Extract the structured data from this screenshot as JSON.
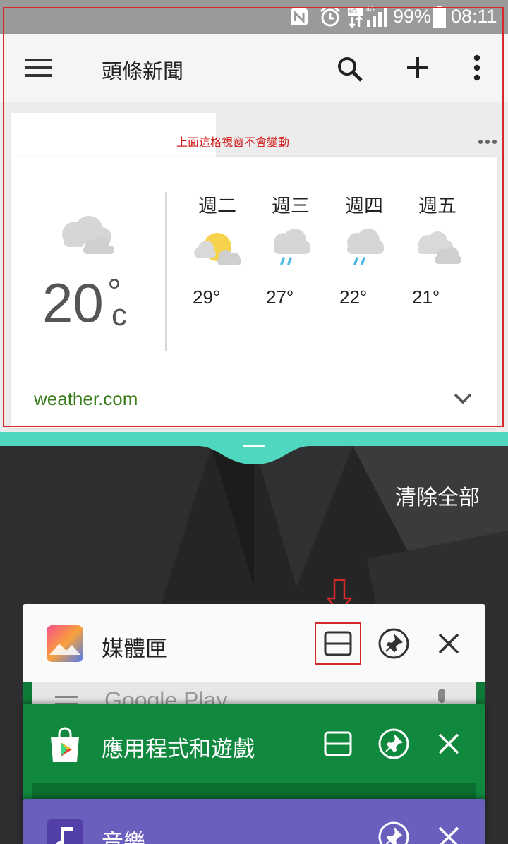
{
  "status_bar": {
    "battery": "99%",
    "time": "08:11",
    "network_type": "4G",
    "icons": [
      "nfc-icon",
      "alarm-icon",
      "data-arrows-icon",
      "signal-icon",
      "battery-icon"
    ]
  },
  "app_bar": {
    "title": "頭條新聞",
    "icons": [
      "menu-icon",
      "search-icon",
      "add-icon",
      "more-vert-icon"
    ]
  },
  "annotation": {
    "note": "上面這格視窗不會變動",
    "color": "#d62929"
  },
  "weather": {
    "current_temp": "20",
    "degree_symbol": "°",
    "unit": "c",
    "current_icon": "cloudy-icon",
    "source": "weather.com",
    "source_color": "#3a7d1c",
    "forecast": [
      {
        "day": "週二",
        "temp": "29°",
        "icon": "partly-sunny-icon"
      },
      {
        "day": "週三",
        "temp": "27°",
        "icon": "rain-icon"
      },
      {
        "day": "週四",
        "temp": "22°",
        "icon": "rain-icon"
      },
      {
        "day": "週五",
        "temp": "21°",
        "icon": "cloudy-icon"
      }
    ]
  },
  "split": {
    "accent": "#4fd8bf"
  },
  "recents": {
    "clear_all": "清除全部",
    "tasks": [
      {
        "name": "媒體匣",
        "header_color": "#fafafa",
        "text_color": "#222222",
        "icon": "gallery-icon"
      },
      {
        "name": "應用程式和遊戲",
        "header_color": "#10883e",
        "text_color": "#ffffff",
        "icon": "play-store-icon",
        "preview_text": "Google Play"
      },
      {
        "name": "音樂",
        "header_color": "#6a5fbd",
        "text_color": "#ffffff",
        "icon": "music-icon"
      }
    ]
  }
}
